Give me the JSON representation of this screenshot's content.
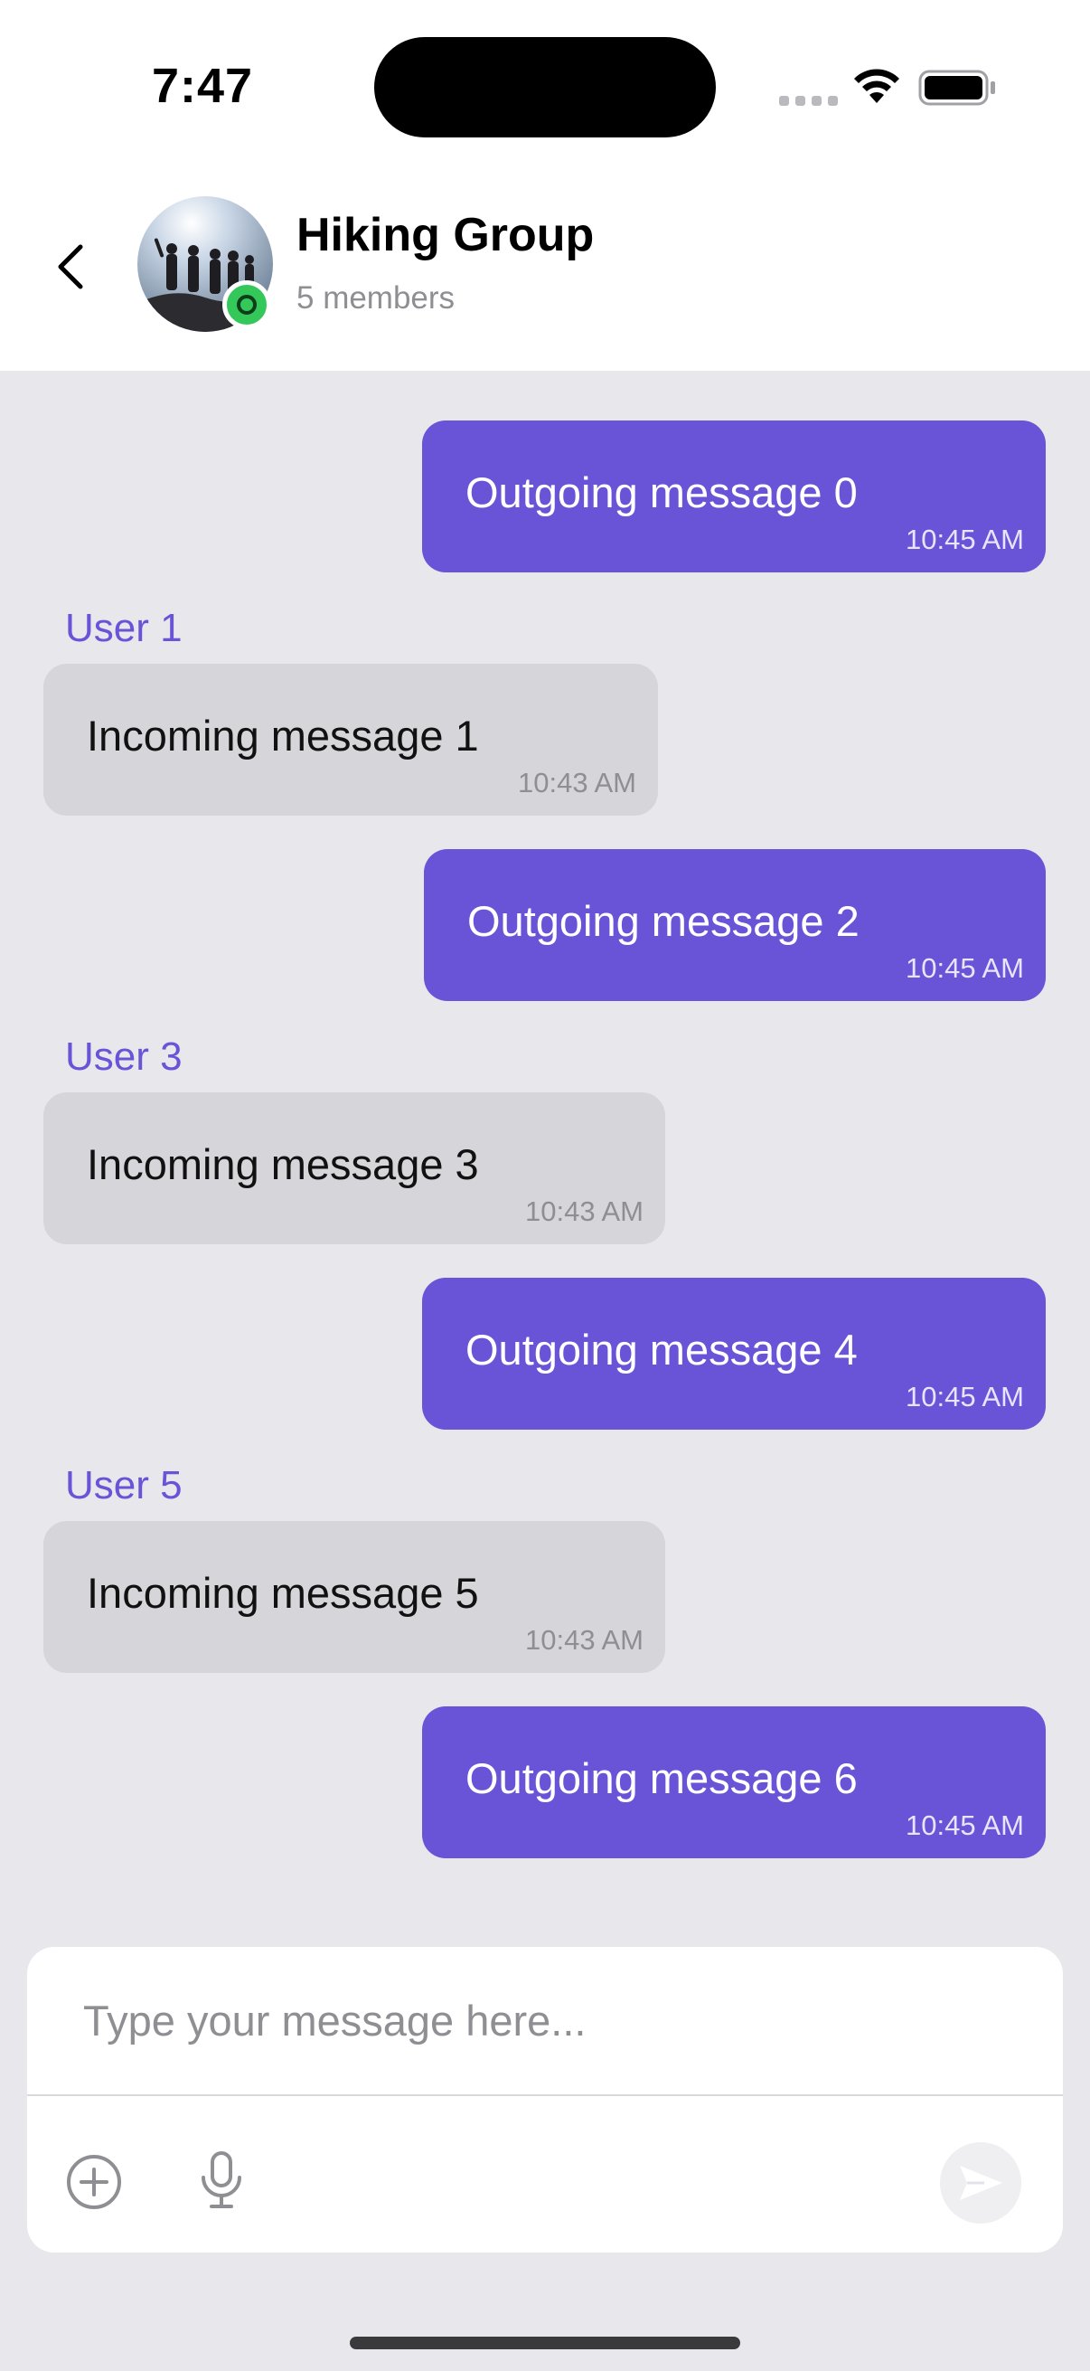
{
  "status_bar": {
    "time": "7:47"
  },
  "header": {
    "back_icon": "chevron-left-icon",
    "title": "Hiking Group",
    "subtitle": "5 members",
    "online_color": "#34c759"
  },
  "colors": {
    "accent": "#6953d7",
    "incoming_bubble": "#d6d6da",
    "background": "#e7e7ec"
  },
  "messages": [
    {
      "direction": "outgoing",
      "text": "Outgoing message 0",
      "time": "10:45 AM"
    },
    {
      "direction": "incoming",
      "sender": "User 1",
      "text": "Incoming message 1",
      "time": "10:43 AM"
    },
    {
      "direction": "outgoing",
      "text": "Outgoing message 2",
      "time": "10:45 AM"
    },
    {
      "direction": "incoming",
      "sender": "User 3",
      "text": "Incoming message 3",
      "time": "10:43 AM"
    },
    {
      "direction": "outgoing",
      "text": "Outgoing message 4",
      "time": "10:45 AM"
    },
    {
      "direction": "incoming",
      "sender": "User 5",
      "text": "Incoming message 5",
      "time": "10:43 AM"
    },
    {
      "direction": "outgoing",
      "text": "Outgoing message 6",
      "time": "10:45 AM"
    }
  ],
  "composer": {
    "placeholder": "Type your message here...",
    "value": "",
    "add_icon": "plus-circle-icon",
    "mic_icon": "microphone-icon",
    "send_icon": "send-icon"
  }
}
